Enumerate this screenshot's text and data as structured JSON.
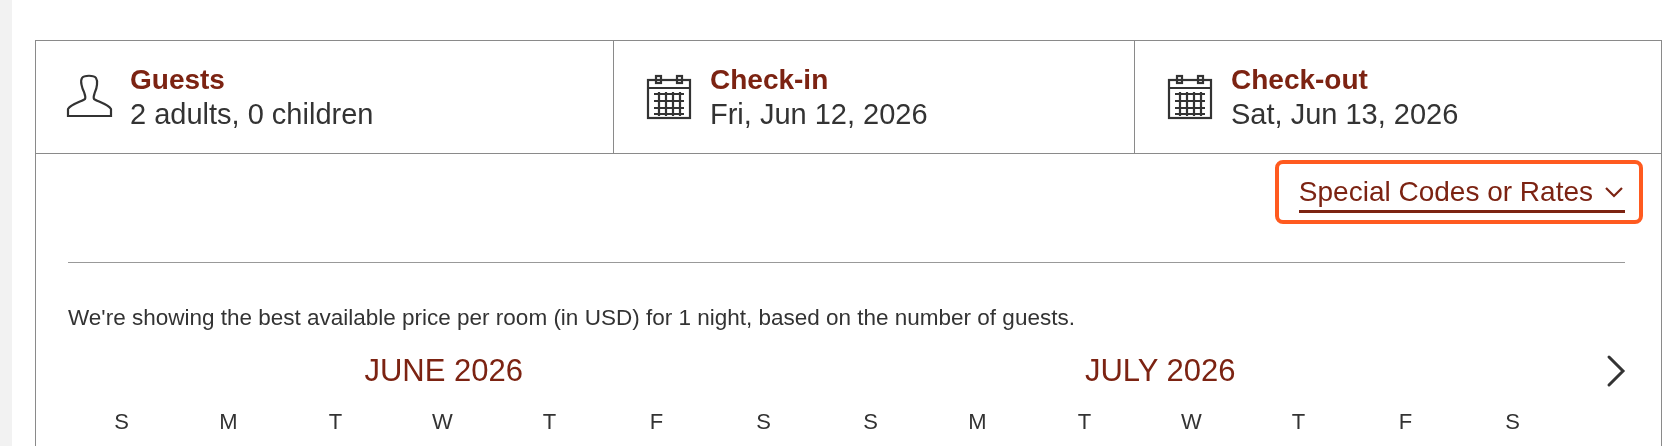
{
  "fields": [
    {
      "kind": "guests",
      "label": "Guests",
      "value": "2 adults, 0 children"
    },
    {
      "kind": "date",
      "label": "Check-in",
      "value": "Fri, Jun 12, 2026"
    },
    {
      "kind": "date",
      "label": "Check-out",
      "value": "Sat, Jun 13, 2026"
    }
  ],
  "special_codes": {
    "label": "Special Codes or Rates",
    "expanded": false,
    "focused": true
  },
  "note": "We're showing the best available price per room (in USD) for 1 night, based on the number of guests.",
  "months": [
    {
      "title": "JUNE 2026",
      "weekdays": [
        "S",
        "M",
        "T",
        "W",
        "T",
        "F",
        "S"
      ]
    },
    {
      "title": "JULY 2026",
      "weekdays": [
        "S",
        "M",
        "T",
        "W",
        "T",
        "F",
        "S"
      ]
    }
  ]
}
